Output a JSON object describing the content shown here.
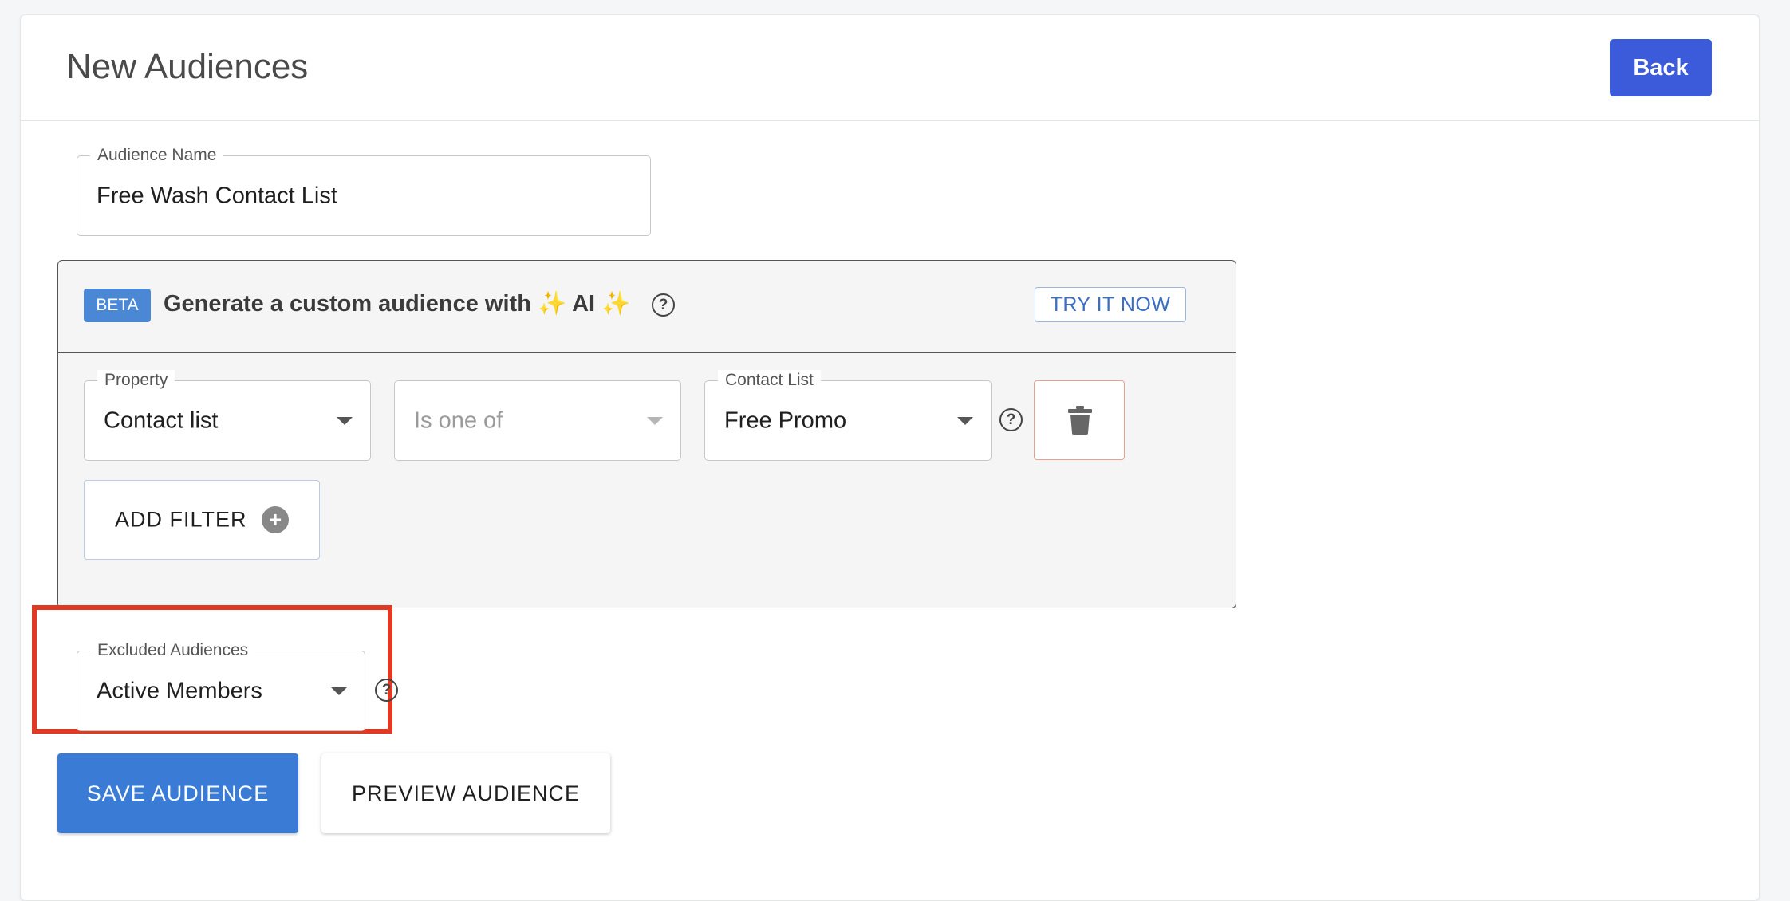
{
  "header": {
    "title": "New Audiences",
    "back_label": "Back"
  },
  "audience_name": {
    "label": "Audience Name",
    "value": "Free Wash Contact List"
  },
  "ai_generator": {
    "badge": "BETA",
    "title_prefix": "Generate a custom audience with ",
    "sparkle": "✨",
    "ai_word": " AI ",
    "help_icon": "?",
    "try_label": "TRY IT NOW"
  },
  "filters": [
    {
      "property": {
        "label": "Property",
        "value": "Contact list"
      },
      "operator": {
        "label": "",
        "value": "Is one of"
      },
      "contact_list": {
        "label": "Contact List",
        "value": "Free Promo"
      }
    }
  ],
  "add_filter_label": "ADD FILTER",
  "excluded_audiences": {
    "label": "Excluded Audiences",
    "value": "Active Members"
  },
  "actions": {
    "save_label": "SAVE AUDIENCE",
    "preview_label": "PREVIEW AUDIENCE"
  },
  "icons": {
    "help": "question-circle-icon",
    "dropdown": "caret-down-icon",
    "delete": "trash-icon",
    "add": "plus-circle-icon"
  },
  "colors": {
    "primary": "#3b5bdb",
    "save": "#3a7bd5",
    "beta": "#4a88d6",
    "highlight": "#e03a25"
  }
}
